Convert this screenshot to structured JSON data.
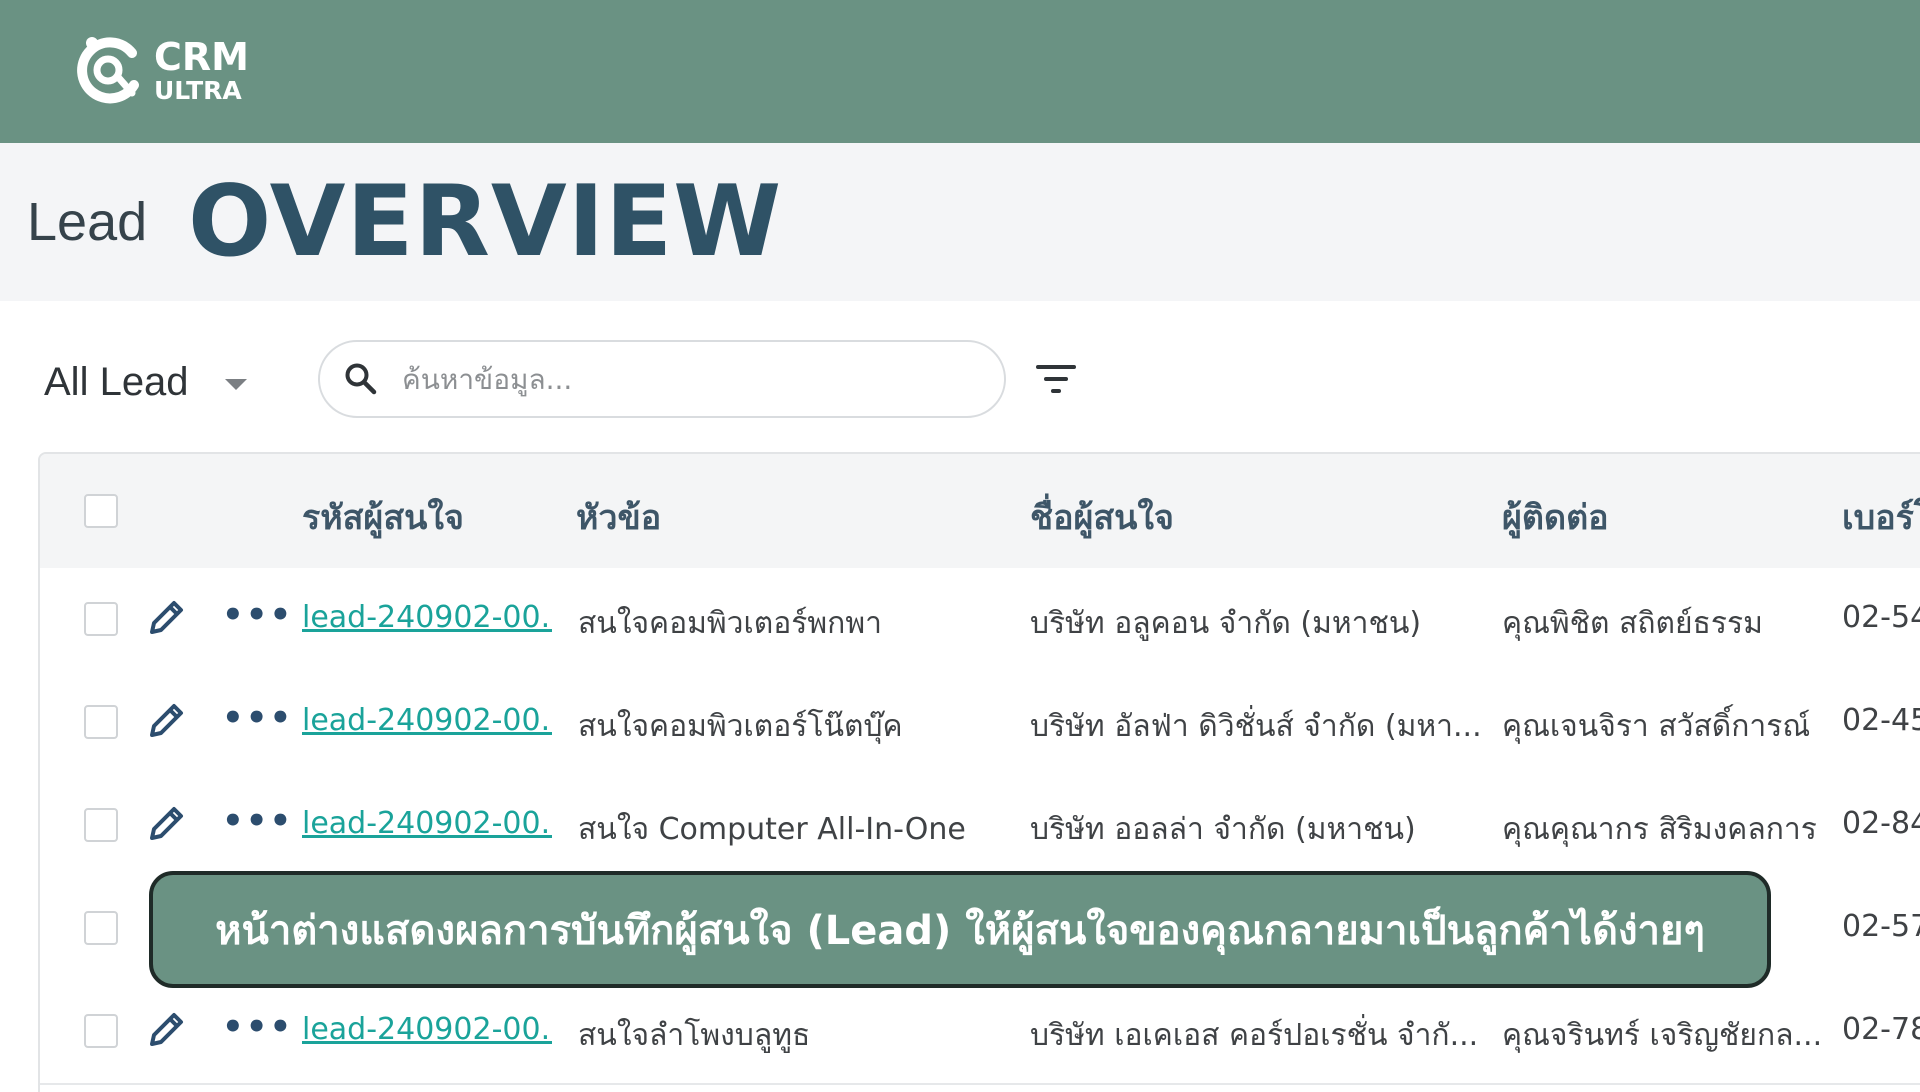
{
  "brand": {
    "line1": "CRM",
    "line2": "ULTRA",
    "color": "#6a9283"
  },
  "hero": {
    "small": "Lead",
    "big": "OVERVIEW"
  },
  "toolbar": {
    "view_label": "All Lead",
    "search_placeholder": "ค้นหาข้อมูล...",
    "search_icon": "search-icon",
    "filter_icon": "filter-icon"
  },
  "table": {
    "headers": [
      "รหัสผู้สนใจ",
      "หัวข้อ",
      "ชื่อผู้สนใจ",
      "ผู้ติดต่อ",
      "เบอร์โ"
    ],
    "rows": [
      {
        "code": "lead-240902-00...",
        "topic": "สนใจคอมพิวเตอร์พกพา",
        "name": "บริษัท อลูคอน จำกัด (มหาชน)",
        "contact": "คุณพิชิต สถิตย์ธรรม",
        "phone": "02-54"
      },
      {
        "code": "lead-240902-00...",
        "topic": "สนใจคอมพิวเตอร์โน๊ตบุ๊ค",
        "name": "บริษัท อัลฟ่า ดิวิชั่นส์ จำกัด (มหา...",
        "contact": "คุณเจนจิรา สวัสดิ์การณ์",
        "phone": "02-45"
      },
      {
        "code": "lead-240902-00...",
        "topic": "สนใจ Computer All-In-One",
        "name": "บริษัท ออลล่า จำกัด (มหาชน)",
        "contact": "คุณคุณากร สิริมงคลการ",
        "phone": "02-84"
      },
      {
        "code": "",
        "topic": "",
        "name": "",
        "contact": "",
        "phone": "02-57"
      },
      {
        "code": "lead-240902-00...",
        "topic": "สนใจลำโพงบลูทูธ",
        "name": "บริษัท เอเคเอส คอร์ปอเรชั่น จำกั...",
        "contact": "คุณจรินทร์ เจริญชัยกล...",
        "phone": "02-78"
      }
    ]
  },
  "banner": {
    "text": "หน้าต่างแสดงผลการบันทึกผู้สนใจ (Lead) ให้ผู้สนใจของคุณกลายมาเป็นลูกค้าได้ง่ายๆ"
  }
}
